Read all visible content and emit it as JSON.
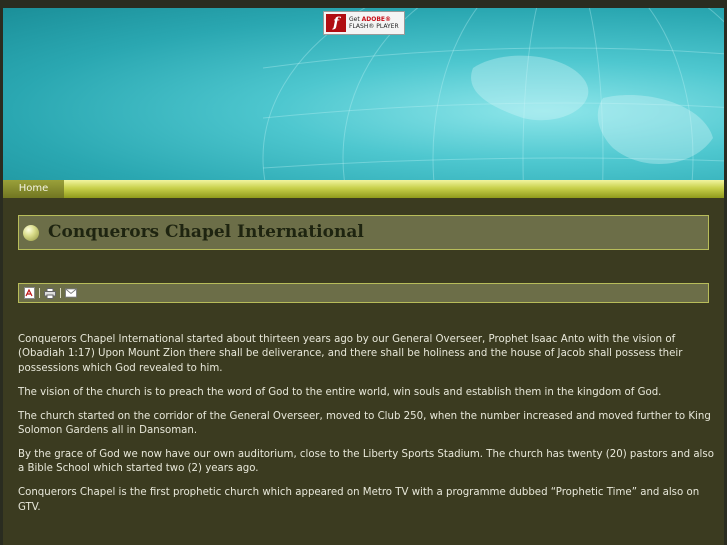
{
  "flash_badge": {
    "line1_prefix": "Get ",
    "line1_brand": "ADOBE®",
    "line2": "FLASH® PLAYER",
    "logo_glyph": "f",
    "icon": "adobe-flash-icon"
  },
  "nav": {
    "home": "Home"
  },
  "article": {
    "title": "Conquerors Chapel International",
    "tools": [
      {
        "name": "pdf-icon",
        "label": "PDF"
      },
      {
        "name": "print-icon",
        "label": "Print"
      },
      {
        "name": "email-icon",
        "label": "Email"
      }
    ],
    "paragraphs": [
      "Conquerors Chapel International started about thirteen years ago by our General Overseer, Prophet Isaac Anto with the vision of (Obadiah 1:17) Upon Mount Zion there shall be deliverance, and there shall be holiness and the house of Jacob shall possess their possessions which God revealed to him.",
      "The vision of the church is to preach the word of God to the entire world, win souls and establish them in the kingdom of God.",
      "The church started on the corridor of the General Overseer, moved to Club 250, when the number increased and moved further to King Solomon Gardens all in Dansoman.",
      "By the grace of God we now have our own auditorium, close to the Liberty Sports Stadium. The church has twenty (20) pastors and also a Bible School which started two (2) years ago.",
      "Conquerors Chapel is the first prophetic church which appeared on Metro TV with a programme dubbed “Prophetic Time” and also on GTV."
    ]
  },
  "colors": {
    "banner": "#2aa7b1",
    "content_bg": "#3b3b20",
    "navbar": "#c8d04a",
    "title_box": "#6c6e48"
  }
}
